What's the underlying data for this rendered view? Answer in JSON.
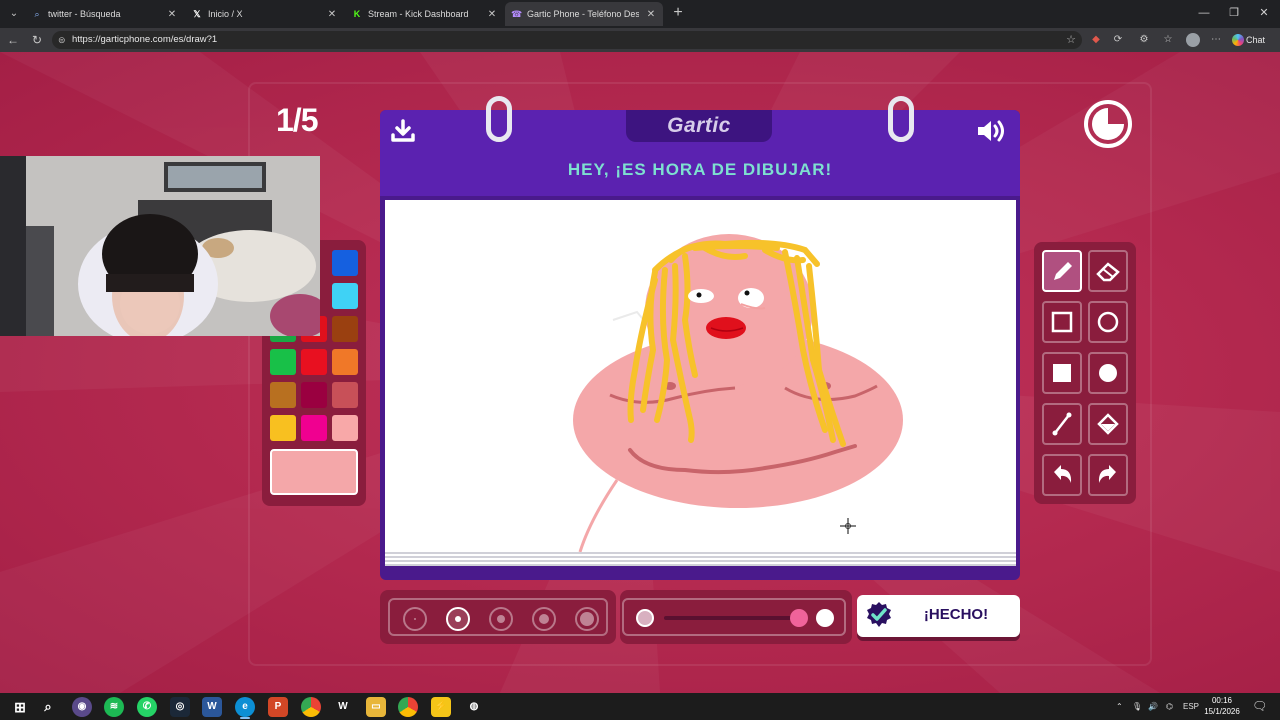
{
  "browser": {
    "tabs": [
      {
        "title": "twitter - Búsqueda",
        "favicon": "search-icon",
        "active": false
      },
      {
        "title": "Inicio / X",
        "favicon": "x-logo-icon",
        "active": false
      },
      {
        "title": "Stream - Kick Dashboard",
        "favicon": "kick-logo-icon",
        "active": false
      },
      {
        "title": "Gartic Phone - Teléfono Descomp",
        "favicon": "gartic-logo-icon",
        "active": true
      }
    ],
    "url": "https://garticphone.com/es/draw?1",
    "chat_label": "Chat"
  },
  "game": {
    "round": "1/5",
    "logo": "Gartic",
    "title": "HEY, ¡ES HORA DE DIBUJAR!",
    "done_label": "¡HECHO!",
    "current_color": "#f4a7a9",
    "palette_colors": [
      "#1560e0",
      "#3fd2f5",
      "#1aa844",
      "#e0101c",
      "#9a4010",
      "#18c048",
      "#e81020",
      "#f07828",
      "#b87020",
      "#9a0040",
      "#c85058",
      "#f8c020",
      "#f00090",
      "#f8a8a8"
    ],
    "tools": [
      "pencil-icon",
      "eraser-icon",
      "rectangle-outline-icon",
      "circle-outline-icon",
      "rectangle-filled-icon",
      "circle-filled-icon",
      "line-icon",
      "fill-bucket-icon",
      "undo-icon",
      "redo-icon"
    ],
    "selected_tool": "pencil-icon",
    "brush_sizes": 5,
    "selected_brush_size": 2
  },
  "taskbar": {
    "language": "ESP",
    "time": "00:16",
    "date": "15/1/2026"
  }
}
